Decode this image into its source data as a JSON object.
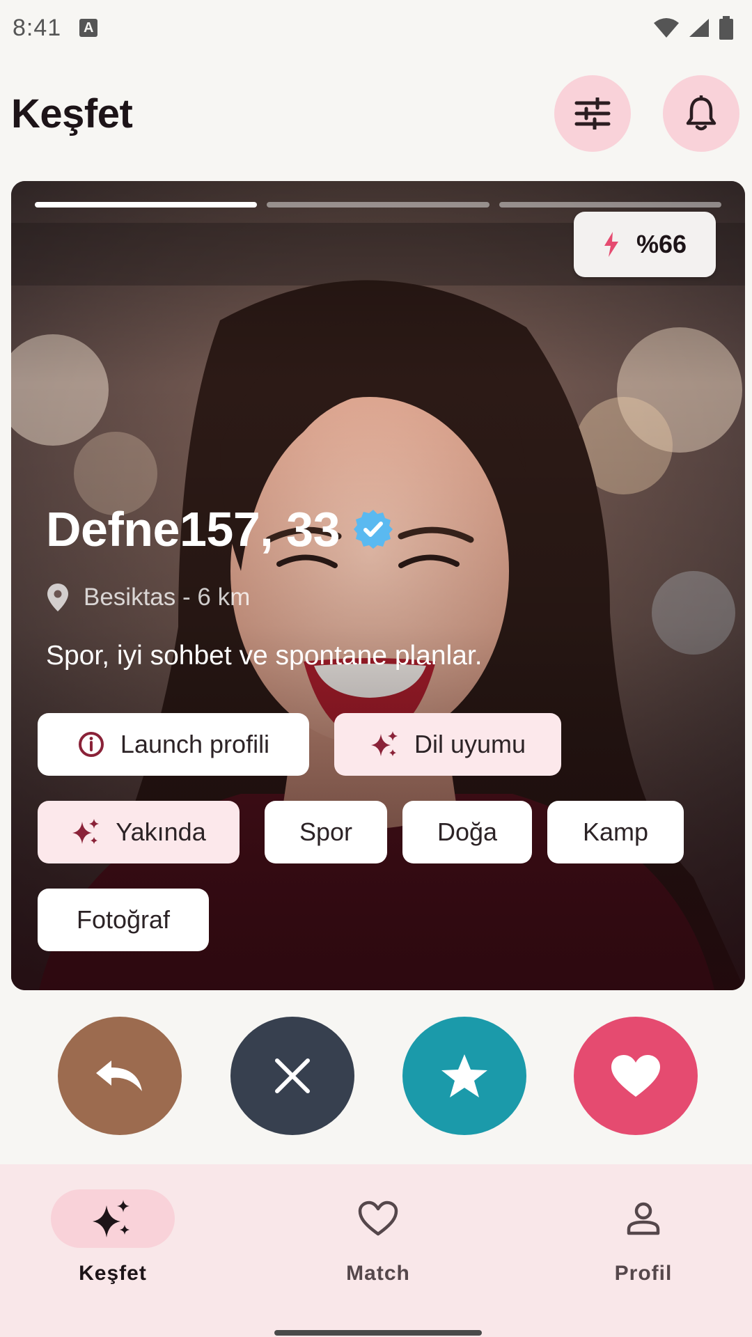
{
  "status_bar": {
    "time": "8:41",
    "keyboard_indicator": "A"
  },
  "header": {
    "title": "Keşfet",
    "filter_icon": "sliders-icon",
    "notification_icon": "bell-icon"
  },
  "card": {
    "photo_progress": {
      "total": 3,
      "current": 1
    },
    "match": {
      "icon": "lightning-icon",
      "label": "%66"
    },
    "name_age": "Defne157, 33",
    "verified_icon": "verified-badge-icon",
    "location": "Besiktas - 6 km",
    "bio": "Spor, iyi sohbet ve spontane planlar.",
    "chips": [
      {
        "label": "Launch profili",
        "icon": "info-icon",
        "style": "white"
      },
      {
        "label": "Dil uyumu",
        "icon": "sparkle-icon",
        "style": "pink"
      },
      {
        "label": "Yakında",
        "icon": "sparkle-icon",
        "style": "pink"
      },
      {
        "label": "Spor",
        "style": "white"
      },
      {
        "label": "Doğa",
        "style": "white"
      },
      {
        "label": "Kamp",
        "style": "white"
      },
      {
        "label": "Fotoğraf",
        "style": "white"
      }
    ]
  },
  "actions": [
    {
      "name": "undo",
      "icon": "undo-icon",
      "color": "#9c6b4f"
    },
    {
      "name": "pass",
      "icon": "close-icon",
      "color": "#37404f"
    },
    {
      "name": "super-like",
      "icon": "star-icon",
      "color": "#1b9aaa"
    },
    {
      "name": "like",
      "icon": "heart-icon",
      "color": "#e54b70"
    }
  ],
  "bottom_nav": {
    "items": [
      {
        "label": "Keşfet",
        "icon": "sparkles-icon",
        "active": true
      },
      {
        "label": "Match",
        "icon": "heart-outline-icon",
        "active": false
      },
      {
        "label": "Profil",
        "icon": "person-icon",
        "active": false
      }
    ]
  },
  "colors": {
    "background": "#f7f6f3",
    "accent_pink": "#f9d2d9",
    "nav_background": "#f9e7e9",
    "verified_blue": "#5ab9f0",
    "lightning_red": "#e54b70"
  }
}
